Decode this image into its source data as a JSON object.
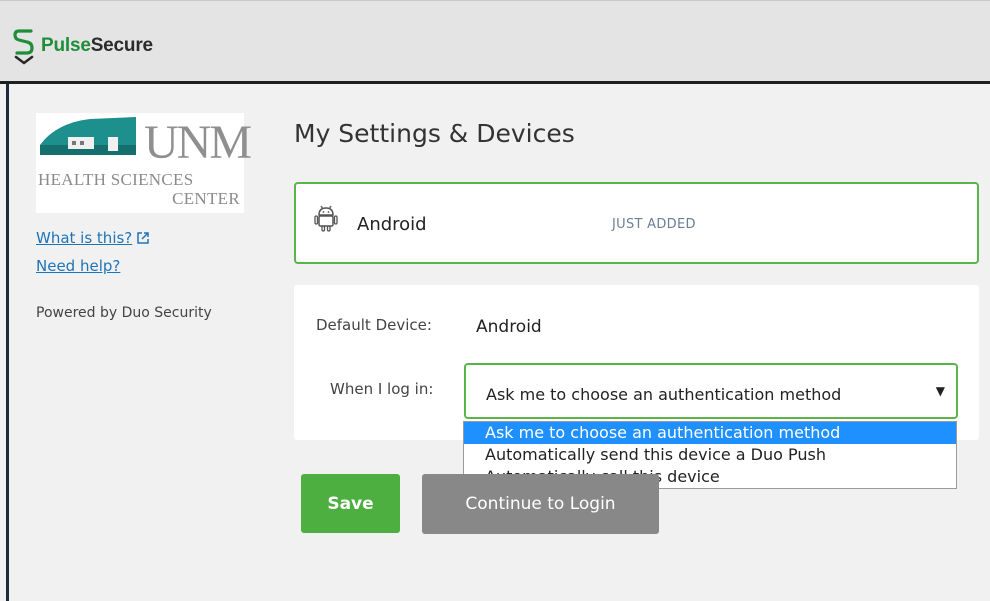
{
  "header": {
    "brand_part1": "Pulse",
    "brand_part2": "Secure",
    "logo_icon": "pulse-secure-s-icon"
  },
  "sidebar": {
    "logo": {
      "letters": "UNM",
      "line1": "HEALTH SCIENCES",
      "line2": "CENTER"
    },
    "links": {
      "what_is_this": "What is this?",
      "need_help": "Need help?"
    },
    "powered_by": "Powered by Duo Security"
  },
  "main": {
    "title": "My Settings & Devices",
    "device": {
      "name": "Android",
      "status": "JUST ADDED",
      "icon": "android-icon"
    },
    "settings": {
      "default_device_label": "Default Device:",
      "default_device_value": "Android",
      "when_login_label": "When I log in:",
      "selected_option": "Ask me to choose an authentication method",
      "options": [
        "Ask me to choose an authentication method",
        "Automatically send this device a Duo Push",
        "Automatically call this device"
      ]
    },
    "buttons": {
      "save": "Save",
      "continue": "Continue to Login"
    }
  },
  "colors": {
    "accent_green": "#5ab44c",
    "save_green": "#4caf3f",
    "link_blue": "#1f74b8",
    "selected_blue": "#1e90ff",
    "unm_teal": "#1d8f8c"
  }
}
